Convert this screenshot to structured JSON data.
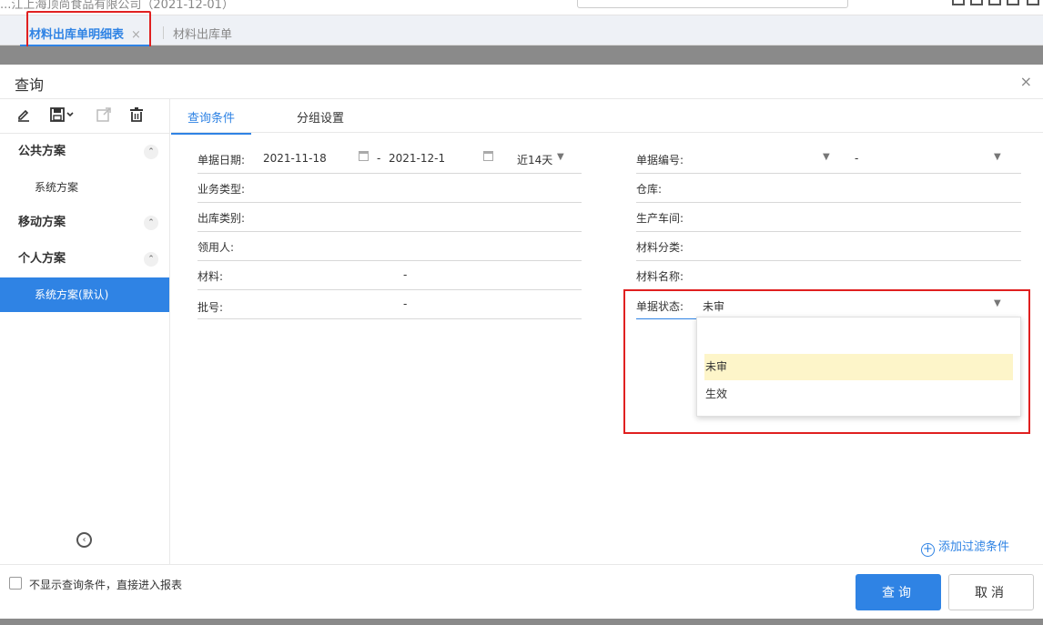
{
  "appbar": {
    "company": "...江上海顶尚食品有限公司（2021-12-01）"
  },
  "tabs": {
    "active": "材料出库单明细表",
    "close_icon": "×",
    "second": "材料出库单"
  },
  "modal": {
    "title": "查询",
    "close": "×"
  },
  "left": {
    "groups": [
      {
        "label": "公共方案",
        "items": [
          "系统方案"
        ]
      },
      {
        "label": "移动方案",
        "items": []
      },
      {
        "label": "个人方案",
        "items": [
          "系统方案(默认)"
        ]
      }
    ],
    "chevron": "⌃",
    "collapse": "‹"
  },
  "right_tabs": {
    "query": "查询条件",
    "group": "分组设置"
  },
  "fields": {
    "doc_date_label": "单据日期:",
    "date_from": "2021-11-18",
    "date_sep": "-",
    "date_to": "2021-12-1",
    "date_preset": "近14天",
    "biz_type": "业务类型:",
    "out_category": "出库类别:",
    "receiver": "领用人:",
    "material": "材料:",
    "material_sep": "-",
    "batch": "批号:",
    "batch_sep": "-",
    "doc_no": "单据编号:",
    "doc_no_sep": "-",
    "warehouse": "仓库:",
    "workshop": "生产车间:",
    "material_cat": "材料分类:",
    "material_name": "材料名称:",
    "doc_status": "单据状态:",
    "doc_status_value": "未审"
  },
  "status_options": [
    "未审",
    "生效"
  ],
  "add_filter": "添加过滤条件",
  "footer": {
    "checkbox_label": "不显示查询条件，直接进入报表",
    "query_btn": "查询",
    "cancel_btn": "取消"
  },
  "colors": {
    "accent": "#2f83e4",
    "highlight": "#e02020",
    "hover": "#fdf5c9"
  }
}
